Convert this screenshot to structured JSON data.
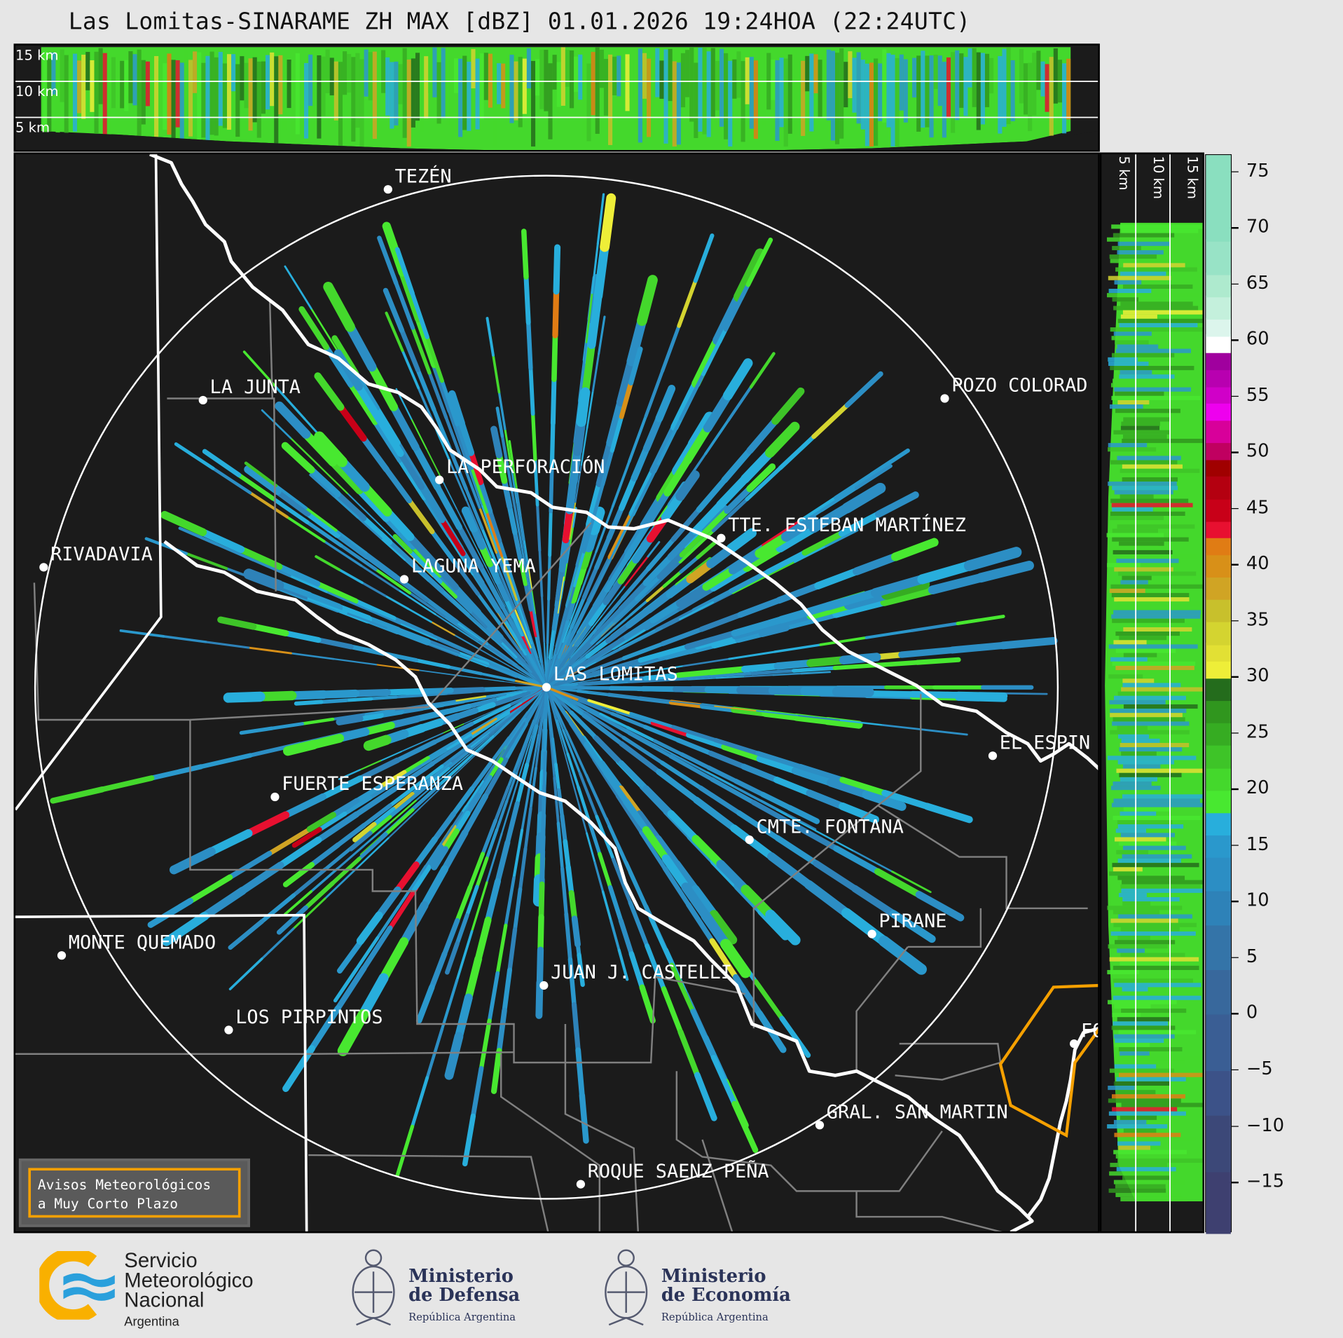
{
  "title": "Las Lomitas-SINARAME ZH MAX [dBZ] 01.01.2026 19:24HOA (22:24UTC)",
  "top_panel": {
    "height_labels": [
      "15 km",
      "10 km",
      "5 km"
    ]
  },
  "right_panel": {
    "height_labels": [
      "5 km",
      "10 km",
      "15 km"
    ]
  },
  "map": {
    "radar_site": "LAS LOMITAS",
    "cities": [
      "TEZÉN",
      "LA JUNTA",
      "LA PERFORACIÓN",
      "POZO COLORAD",
      "TTE. ESTEBAN MARTÍNEZ",
      "RIVADAVIA",
      "LAGUNA YEMA",
      "LAS LOMITAS",
      "EL ESPIN",
      "FUERTE ESPERANZA",
      "CMTE. FONTANA",
      "PIRANE",
      "MONTE QUEMADO",
      "JUAN J. CASTELLI",
      "LOS PIRPINTOS",
      "GRAL. SAN MARTIN",
      "ROQUE SAENZ PEÑA",
      "FO"
    ],
    "colors": {
      "background": "#1b1b1b",
      "river": "#ffffff",
      "province_border": "#ffffff",
      "department_border": "#808080",
      "highlight_border": "#f5a000",
      "range_ring": "#ffffff"
    }
  },
  "avisos_box": {
    "line1": "Avisos Meteorológicos",
    "line2": "a Muy Corto Plazo",
    "border_color": "#f5a000"
  },
  "colorbar": {
    "unit": "dBZ",
    "range": [
      -19.5,
      76.5
    ],
    "ticks": [
      "75",
      "70",
      "65",
      "60",
      "55",
      "50",
      "45",
      "40",
      "35",
      "30",
      "25",
      "20",
      "15",
      "10",
      "5",
      "0",
      "−5",
      "−10",
      "−15"
    ],
    "tick_values": [
      75,
      70,
      65,
      60,
      55,
      50,
      45,
      40,
      35,
      30,
      25,
      20,
      15,
      10,
      5,
      0,
      -5,
      -10,
      -15
    ],
    "bands": [
      {
        "from": -19.5,
        "to": -14,
        "color": "#3e4070"
      },
      {
        "from": -14,
        "to": -9,
        "color": "#3c4878"
      },
      {
        "from": -9,
        "to": -5,
        "color": "#3c5288"
      },
      {
        "from": -5,
        "to": 0,
        "color": "#3a5e94"
      },
      {
        "from": 0,
        "to": 4,
        "color": "#38689c"
      },
      {
        "from": 4,
        "to": 8,
        "color": "#3474a8"
      },
      {
        "from": 8,
        "to": 11,
        "color": "#2e82b8"
      },
      {
        "from": 11,
        "to": 14,
        "color": "#2c8ec4"
      },
      {
        "from": 14,
        "to": 16,
        "color": "#2a98cc"
      },
      {
        "from": 16,
        "to": 18,
        "color": "#28aedc"
      },
      {
        "from": 18,
        "to": 20,
        "color": "#48e830"
      },
      {
        "from": 20,
        "to": 22,
        "color": "#44d82c"
      },
      {
        "from": 22,
        "to": 24,
        "color": "#3ec428"
      },
      {
        "from": 24,
        "to": 26,
        "color": "#36ac22"
      },
      {
        "from": 26,
        "to": 28,
        "color": "#30961e"
      },
      {
        "from": 28,
        "to": 30,
        "color": "#246c1c"
      },
      {
        "from": 30,
        "to": 31.5,
        "color": "#eeee38"
      },
      {
        "from": 31.5,
        "to": 33,
        "color": "#e2e034"
      },
      {
        "from": 33,
        "to": 35,
        "color": "#d4d430"
      },
      {
        "from": 35,
        "to": 37,
        "color": "#c8c02c"
      },
      {
        "from": 37,
        "to": 39,
        "color": "#d0a424"
      },
      {
        "from": 39,
        "to": 41,
        "color": "#d89018"
      },
      {
        "from": 41,
        "to": 42.5,
        "color": "#e07c14"
      },
      {
        "from": 42.5,
        "to": 44,
        "color": "#e81030"
      },
      {
        "from": 44,
        "to": 46,
        "color": "#c80018"
      },
      {
        "from": 46,
        "to": 48,
        "color": "#b40010"
      },
      {
        "from": 48,
        "to": 49.5,
        "color": "#a00000"
      },
      {
        "from": 49.5,
        "to": 51,
        "color": "#c00060"
      },
      {
        "from": 51,
        "to": 53,
        "color": "#d8009a"
      },
      {
        "from": 53,
        "to": 54.5,
        "color": "#ee00ee"
      },
      {
        "from": 54.5,
        "to": 56,
        "color": "#d000c8"
      },
      {
        "from": 56,
        "to": 57.5,
        "color": "#b800b0"
      },
      {
        "from": 57.5,
        "to": 59,
        "color": "#a0009e"
      },
      {
        "from": 59,
        "to": 60.5,
        "color": "#ffffff"
      },
      {
        "from": 60.5,
        "to": 62,
        "color": "#dcf5ec"
      },
      {
        "from": 62,
        "to": 64,
        "color": "#c4f0dc"
      },
      {
        "from": 64,
        "to": 66,
        "color": "#aeeace"
      },
      {
        "from": 66,
        "to": 69,
        "color": "#98e3c6"
      },
      {
        "from": 69,
        "to": 76.5,
        "color": "#8adfbf"
      }
    ]
  },
  "footer": {
    "smn": {
      "line1": "Servicio",
      "line2": "Meteorológico",
      "line3": "Nacional",
      "line4": "Argentina"
    },
    "defensa": {
      "line1": "Ministerio",
      "line2": "de Defensa",
      "line3": "República Argentina"
    },
    "economia": {
      "line1": "Ministerio",
      "line2": "de Economía",
      "line3": "República Argentina"
    }
  }
}
